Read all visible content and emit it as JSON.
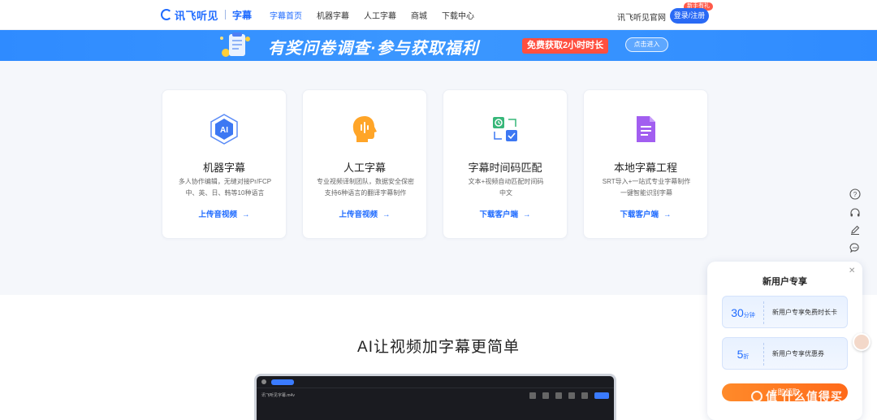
{
  "header": {
    "logo_text": "讯飞听见",
    "logo_sub": "字幕",
    "nav": [
      {
        "label": "字幕首页",
        "active": true
      },
      {
        "label": "机器字幕",
        "active": false
      },
      {
        "label": "人工字幕",
        "active": false
      },
      {
        "label": "商城",
        "active": false
      },
      {
        "label": "下载中心",
        "active": false
      }
    ],
    "site_link": "讯飞听见官网",
    "login_label": "登录/注册",
    "new_tag": "新手有礼"
  },
  "banner": {
    "title": "有奖问卷调查·参与获取福利",
    "badge": "免费获取2小时时长",
    "button": "点击进入"
  },
  "cards": [
    {
      "title": "机器字幕",
      "desc1": "多人协作编辑，无缝对接Pr/FCP",
      "desc2": "中、英、日、韩等10种语言",
      "link": "上传音视频",
      "icon": "ai-chip-icon"
    },
    {
      "title": "人工字幕",
      "desc1": "专业视频译制团队，数据安全保密",
      "desc2": "支持6种语言的翻译字幕制作",
      "link": "上传音视频",
      "icon": "human-voice-icon"
    },
    {
      "title": "字幕时间码匹配",
      "desc1": "文本+视频自动匹配时间码",
      "desc2": "中文",
      "link": "下载客户端",
      "icon": "timecode-match-icon"
    },
    {
      "title": "本地字幕工程",
      "desc1": "SRT导入+一站式专业字幕制作",
      "desc2": "一键智能识别字幕",
      "link": "下载客户端",
      "icon": "document-icon"
    }
  ],
  "section": {
    "title": "AI让视频加字幕更简单",
    "mock_filename": "讯飞听见字幕.m4v"
  },
  "popup": {
    "title": "新用户专享",
    "coupons": [
      {
        "value": "30",
        "unit": "分钟",
        "text": "新用户专享免费时长卡"
      },
      {
        "value": "5",
        "unit": "折",
        "text": "新用户专享优惠券"
      }
    ],
    "button": "立即领取"
  },
  "side_tools": [
    "help-icon",
    "headset-icon",
    "edit-icon",
    "chat-icon"
  ],
  "watermark": "值 什么值得买",
  "colors": {
    "brand": "#1f6bff",
    "banner": "#3b97ff",
    "badge": "#ff4f3f",
    "orange": "#ff7a22"
  }
}
